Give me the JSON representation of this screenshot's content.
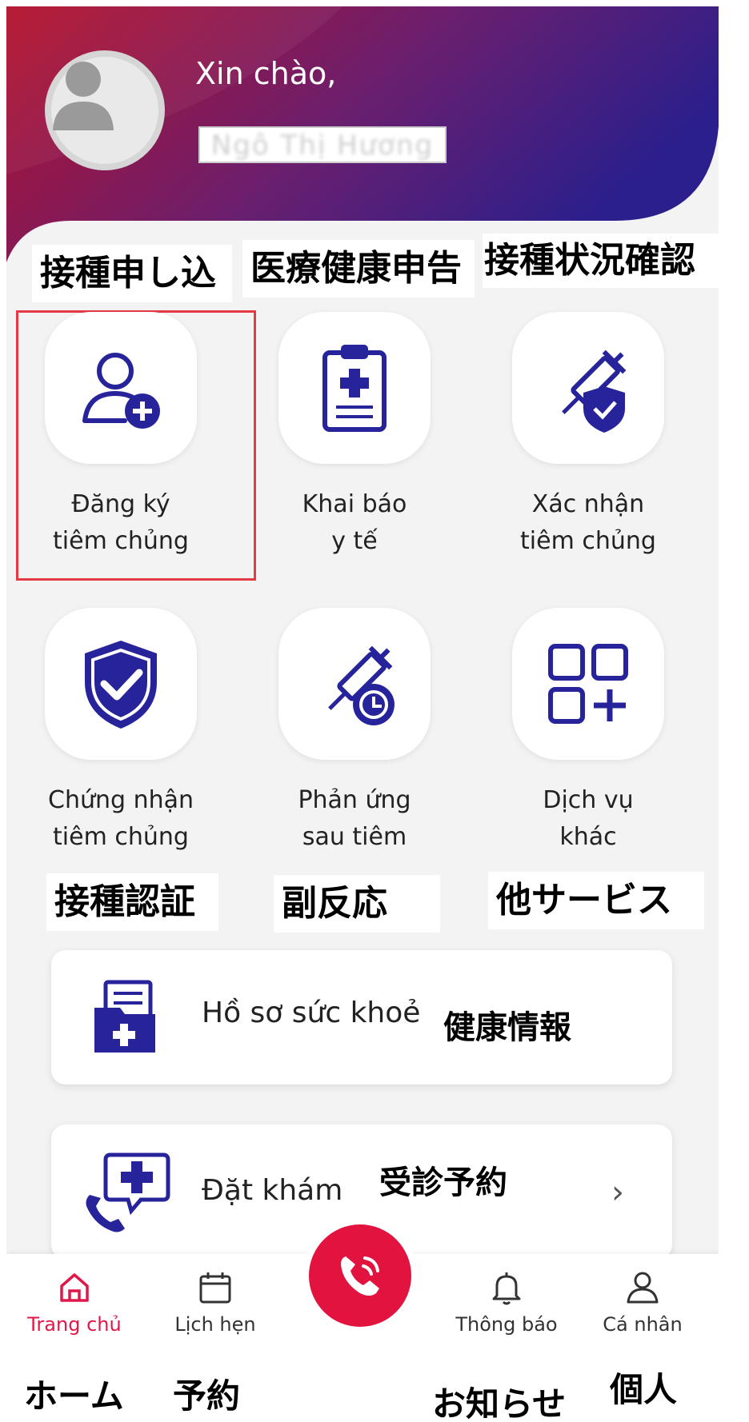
{
  "header": {
    "greeting": "Xin chào,",
    "username": "Ngô Thị Hương"
  },
  "annotations": {
    "register": "接種申し込",
    "medical_decl": "医療健康申告",
    "confirm": "接種状況確認",
    "certificate": "接種認証",
    "reaction": "副反応",
    "other": "他サービス",
    "health_record": "健康情報",
    "booking": "受診予約",
    "nav_home": "ホーム",
    "nav_schedule": "予約",
    "nav_notify": "お知らせ",
    "nav_personal": "個人"
  },
  "services": [
    {
      "line1": "Đăng ký",
      "line2": "tiêm chủng",
      "icon": "user-add-icon"
    },
    {
      "line1": "Khai báo",
      "line2": "y tế",
      "icon": "clipboard-medical-icon"
    },
    {
      "line1": "Xác nhận",
      "line2": "tiêm chủng",
      "icon": "syringe-shield-icon"
    },
    {
      "line1": "Chứng nhận",
      "line2": "tiêm chủng",
      "icon": "shield-check-icon"
    },
    {
      "line1": "Phản ứng",
      "line2": "sau tiêm",
      "icon": "syringe-clock-icon"
    },
    {
      "line1": "Dịch vụ",
      "line2": "khác",
      "icon": "grid-plus-icon"
    }
  ],
  "cards": {
    "health_record": "Hồ sơ sức khoẻ",
    "booking": "Đặt khám",
    "chevron": "›"
  },
  "nav": {
    "home": "Trang chủ",
    "schedule": "Lịch hẹn",
    "notifications": "Thông báo",
    "personal": "Cá nhân"
  },
  "colors": {
    "accent": "#e0184a",
    "icon": "#27249b",
    "header_start": "#b5102a",
    "header_end": "#2a1f8c"
  }
}
